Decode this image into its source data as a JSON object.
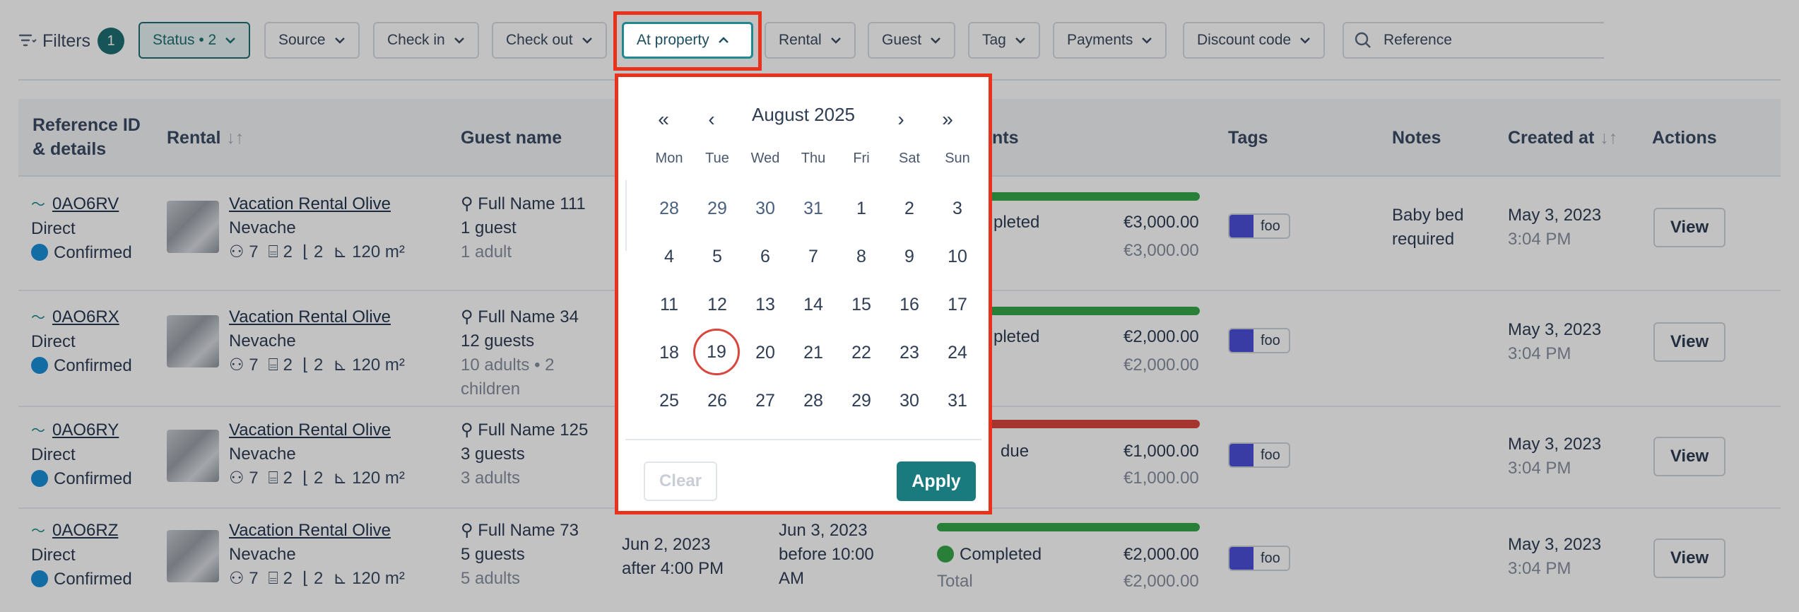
{
  "filters": {
    "label": "Filters",
    "count": "1",
    "buttons": {
      "status": "Status • 2",
      "source": "Source",
      "check_in": "Check in",
      "check_out": "Check out",
      "at_property": "At property",
      "rental": "Rental",
      "guest": "Guest",
      "tag": "Tag",
      "payments": "Payments",
      "discount_code": "Discount code"
    },
    "search_value": "Reference"
  },
  "table": {
    "headers": {
      "reference": "Reference ID",
      "reference_line2": "& details",
      "rental": "Rental",
      "guest": "Guest name",
      "payments_partial": "nts",
      "tags": "Tags",
      "notes": "Notes",
      "created": "Created at",
      "actions": "Actions"
    },
    "rows": [
      {
        "ref": "0AO6RV",
        "source": "Direct",
        "status": "Confirmed",
        "rental": "Vacation Rental Olive",
        "city": "Nevache",
        "guests_icon": "7",
        "beds": "2",
        "baths": "2",
        "area": "120 m²",
        "guest_name": "Full Name 111",
        "guest_count": "1 guest",
        "guest_detail": "1 adult",
        "guest_detail2": "",
        "checkin_date": "",
        "checkin_time": "",
        "checkout_date": "",
        "checkout_time": "",
        "checkout_time2": "",
        "pay_status": "pleted",
        "pay_amount": "€3,000.00",
        "pay_total_label": "",
        "pay_total": "€3,000.00",
        "tag": "foo",
        "notes": "Baby bed",
        "notes2": "required",
        "created_date": "May 3, 2023",
        "created_time": "3:04 PM",
        "action": "View"
      },
      {
        "ref": "0AO6RX",
        "source": "Direct",
        "status": "Confirmed",
        "rental": "Vacation Rental Olive",
        "city": "Nevache",
        "guests_icon": "7",
        "beds": "2",
        "baths": "2",
        "area": "120 m²",
        "guest_name": "Full Name 34",
        "guest_count": "12 guests",
        "guest_detail": "10 adults • 2",
        "guest_detail2": "children",
        "checkin_date": "",
        "checkin_time": "",
        "checkout_date": "",
        "checkout_time": "",
        "checkout_time2": "",
        "pay_status": "pleted",
        "pay_amount": "€2,000.00",
        "pay_total_label": "",
        "pay_total": "€2,000.00",
        "tag": "foo",
        "notes": "",
        "notes2": "",
        "created_date": "May 3, 2023",
        "created_time": "3:04 PM",
        "action": "View"
      },
      {
        "ref": "0AO6RY",
        "source": "Direct",
        "status": "Confirmed",
        "rental": "Vacation Rental Olive",
        "city": "Nevache",
        "guests_icon": "7",
        "beds": "2",
        "baths": "2",
        "area": "120 m²",
        "guest_name": "Full Name 125",
        "guest_count": "3 guests",
        "guest_detail": "3 adults",
        "guest_detail2": "",
        "checkin_date": "",
        "checkin_time": "",
        "checkout_date": "",
        "checkout_time": "",
        "checkout_time2": "",
        "pay_status": "due",
        "pay_amount": "€1,000.00",
        "pay_total_label": "",
        "pay_total": "€1,000.00",
        "tag": "foo",
        "notes": "",
        "notes2": "",
        "created_date": "May 3, 2023",
        "created_time": "3:04 PM",
        "action": "View"
      },
      {
        "ref": "0AO6RZ",
        "source": "Direct",
        "status": "Confirmed",
        "rental": "Vacation Rental Olive",
        "city": "Nevache",
        "guests_icon": "7",
        "beds": "2",
        "baths": "2",
        "area": "120 m²",
        "guest_name": "Full Name 73",
        "guest_count": "5 guests",
        "guest_detail": "5 adults",
        "guest_detail2": "",
        "checkin_date": "Jun 2, 2023",
        "checkin_time": "after 4:00 PM",
        "checkout_date": "Jun 3, 2023",
        "checkout_time": "before 10:00",
        "checkout_time2": "AM",
        "pay_status": "Completed",
        "pay_amount": "€2,000.00",
        "pay_total_label": "Total",
        "pay_total": "€2,000.00",
        "tag": "foo",
        "notes": "",
        "notes2": "",
        "created_date": "May 3, 2023",
        "created_time": "3:04 PM",
        "action": "View"
      }
    ]
  },
  "calendar": {
    "month_label": "August 2025",
    "nav": {
      "prev_year": "«",
      "prev_month": "‹",
      "next_month": "›",
      "next_year": "»"
    },
    "weekdays": [
      "Mon",
      "Tue",
      "Wed",
      "Thu",
      "Fri",
      "Sat",
      "Sun"
    ],
    "weeks": [
      [
        "28",
        "29",
        "30",
        "31",
        "1",
        "2",
        "3"
      ],
      [
        "4",
        "5",
        "6",
        "7",
        "8",
        "9",
        "10"
      ],
      [
        "11",
        "12",
        "13",
        "14",
        "15",
        "16",
        "17"
      ],
      [
        "18",
        "19",
        "20",
        "21",
        "22",
        "23",
        "24"
      ],
      [
        "25",
        "26",
        "27",
        "28",
        "29",
        "30",
        "31"
      ]
    ],
    "today": "19",
    "clear_label": "Clear",
    "apply_label": "Apply"
  },
  "colors": {
    "accent": "#1e6f73",
    "highlight": "#e8321e",
    "completed": "#36a84a",
    "overdue": "#d9463e",
    "tag": "#4b4fd8",
    "confirmed": "#1a8ed8"
  }
}
